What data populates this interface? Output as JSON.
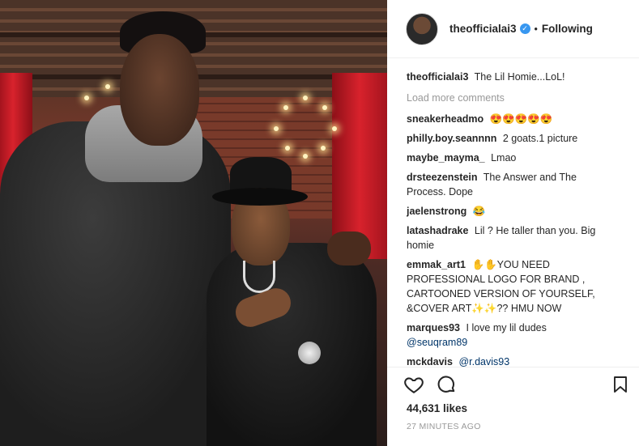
{
  "header": {
    "username": "theofficialai3",
    "separator": "•",
    "follow_status": "Following"
  },
  "caption": {
    "username": "theofficialai3",
    "text": "The Lil Homie...LoL!"
  },
  "load_more": "Load more comments",
  "comments": [
    {
      "user": "sneakerheadmo",
      "text": "😍😍😍😍😍"
    },
    {
      "user": "philly.boy.seannnn",
      "text": "2 goats.1 picture"
    },
    {
      "user": "maybe_mayma_",
      "text": "Lmao"
    },
    {
      "user": "drsteezenstein",
      "text": "The Answer and The Process. Dope"
    },
    {
      "user": "jaelenstrong",
      "text": "😂"
    },
    {
      "user": "latashadrake",
      "text": "Lil ? He taller than you. Big homie"
    },
    {
      "user": "emmak_art1",
      "text": "✋✋YOU NEED PROFESSIONAL LOGO FOR BRAND , CARTOONED VERSION OF YOURSELF, &COVER ART✨✨?? HMU NOW"
    },
    {
      "user": "marques93",
      "text": "I love my lil dudes",
      "mention": "@seuqram89"
    },
    {
      "user": "mckdavis",
      "mention": "@r.davis93"
    }
  ],
  "likes": "44,631 likes",
  "timestamp": "27 MINUTES AGO",
  "icons": {
    "like": "heart-icon",
    "comment": "comment-icon",
    "save": "bookmark-icon",
    "verified": "verified-badge-icon"
  },
  "colors": {
    "verified": "#3897f0",
    "muted": "#999999",
    "text": "#262626"
  }
}
